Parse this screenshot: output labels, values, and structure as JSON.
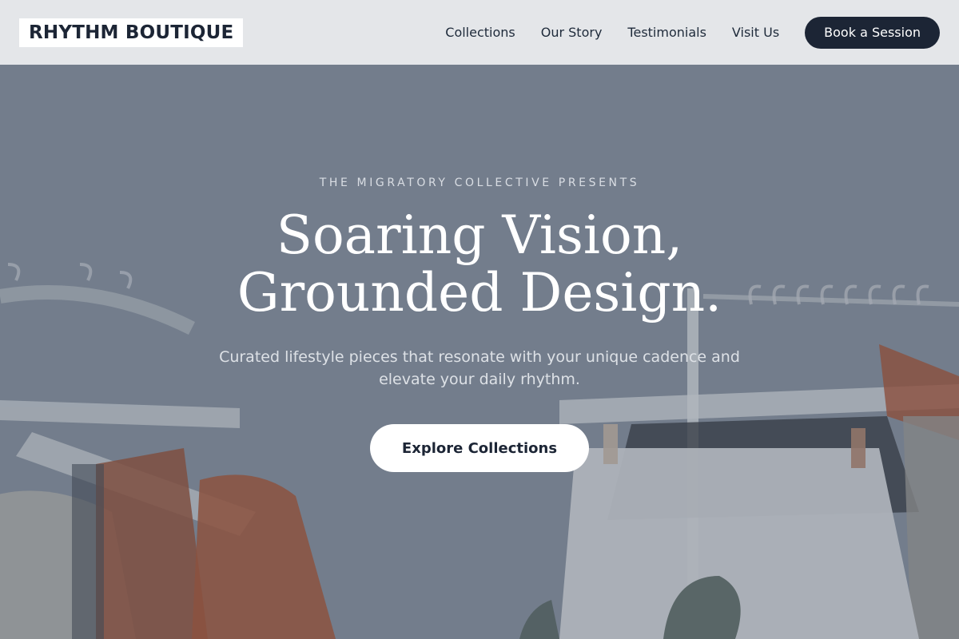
{
  "header": {
    "brand": "RHYTHM BOUTIQUE",
    "nav": [
      {
        "label": "Collections"
      },
      {
        "label": "Our Story"
      },
      {
        "label": "Testimonials"
      },
      {
        "label": "Visit Us"
      }
    ],
    "cta_label": "Book a Session"
  },
  "hero": {
    "eyebrow": "THE MIGRATORY COLLECTIVE PRESENTS",
    "headline_line1": "Soaring Vision,",
    "headline_line2": "Grounded Design.",
    "subtext": "Curated lifestyle pieces that resonate with your unique cadence and elevate your daily rhythm.",
    "cta_label": "Explore Collections",
    "background_description_icon": "clothing-rack-photo"
  },
  "colors": {
    "header_bg": "#e4e6e9",
    "brand_text": "#1c2535",
    "primary_dark": "#1c2535",
    "hero_overlay": "#6f7a87",
    "cta_bg": "#ffffff"
  }
}
